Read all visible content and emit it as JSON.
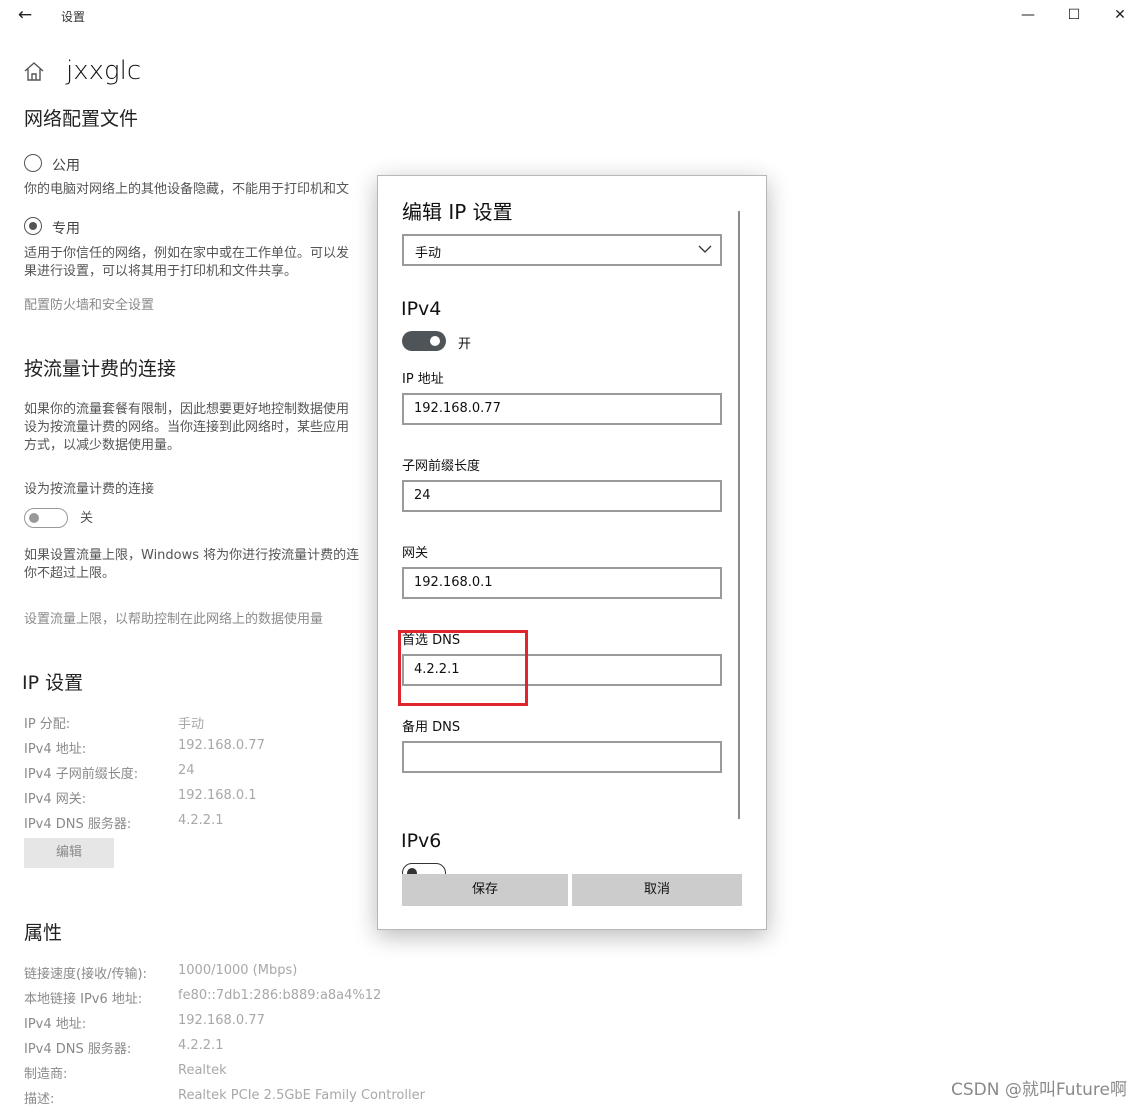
{
  "window": {
    "title": "设置",
    "minimize": "—",
    "maximize": "☐",
    "close": "✕"
  },
  "network": {
    "name": "jxxglc"
  },
  "profile": {
    "heading": "网络配置文件",
    "public_label": "公用",
    "public_desc": "你的电脑对网络上的其他设备隐藏，不能用于打印机和文",
    "private_label": "专用",
    "private_desc_1": "适用于你信任的网络，例如在家中或在工作单位。可以发",
    "private_desc_2": "果进行设置，可以将其用于打印机和文件共享。",
    "firewall_link": "配置防火墙和安全设置"
  },
  "metered": {
    "heading": "按流量计费的连接",
    "desc_1": "如果你的流量套餐有限制，因此想要更好地控制数据使用",
    "desc_2": "设为按流量计费的网络。当你连接到此网络时，某些应用",
    "desc_3": "方式，以减少数据使用量。",
    "toggle_label": "设为按流量计费的连接",
    "toggle_state": "关",
    "limit_desc_1": "如果设置流量上限，Windows 将为你进行按流量计费的连",
    "limit_desc_2": "你不超过上限。",
    "limit_link": "设置流量上限，以帮助控制在此网络上的数据使用量"
  },
  "ip_settings": {
    "heading": "IP 设置",
    "rows": [
      {
        "key": "IP 分配:",
        "value": "手动"
      },
      {
        "key": "IPv4 地址:",
        "value": "192.168.0.77"
      },
      {
        "key": "IPv4 子网前缀长度:",
        "value": "24"
      },
      {
        "key": "IPv4 网关:",
        "value": "192.168.0.1"
      },
      {
        "key": "IPv4 DNS 服务器:",
        "value": "4.2.2.1"
      }
    ],
    "edit_button": "编辑"
  },
  "properties": {
    "heading": "属性",
    "rows": [
      {
        "key": "链接速度(接收/传输):",
        "value": "1000/1000 (Mbps)"
      },
      {
        "key": "本地链接 IPv6 地址:",
        "value": "fe80::7db1:286:b889:a8a4%12"
      },
      {
        "key": "IPv4 地址:",
        "value": "192.168.0.77"
      },
      {
        "key": "IPv4 DNS 服务器:",
        "value": "4.2.2.1"
      },
      {
        "key": "制造商:",
        "value": "Realtek"
      },
      {
        "key": "描述:",
        "value": "Realtek PCIe 2.5GbE Family Controller"
      }
    ]
  },
  "dialog": {
    "title": "编辑 IP 设置",
    "mode": "手动",
    "ipv4_heading": "IPv4",
    "ipv4_toggle_state": "开",
    "ip_label": "IP 地址",
    "ip_value": "192.168.0.77",
    "prefix_label": "子网前缀长度",
    "prefix_value": "24",
    "gateway_label": "网关",
    "gateway_value": "192.168.0.1",
    "dns1_label": "首选 DNS",
    "dns1_value": "4.2.2.1",
    "dns2_label": "备用 DNS",
    "dns2_value": "",
    "ipv6_heading": "IPv6",
    "save_button": "保存",
    "cancel_button": "取消",
    "highlight_color": "#e0262b"
  },
  "watermark": "CSDN @就叫Future啊"
}
